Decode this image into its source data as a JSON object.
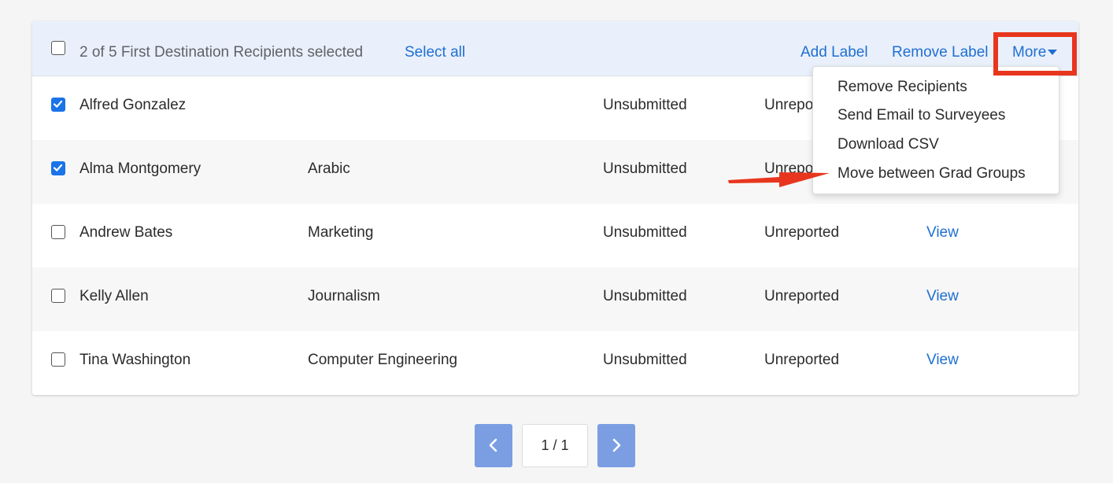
{
  "toolbar": {
    "selection_text": "2 of 5 First Destination Recipients selected",
    "select_all": "Select all",
    "add_label": "Add Label",
    "remove_label": "Remove Label",
    "more": "More"
  },
  "rows": [
    {
      "name": "Alfred Gonzalez",
      "program": "",
      "status": "Unsubmitted",
      "report": "Unrepo",
      "action": "",
      "checked": true
    },
    {
      "name": "Alma Montgomery",
      "program": "Arabic",
      "status": "Unsubmitted",
      "report": "Unrepo",
      "action": "",
      "checked": true
    },
    {
      "name": "Andrew Bates",
      "program": "Marketing",
      "status": "Unsubmitted",
      "report": "Unreported",
      "action": "View",
      "checked": false
    },
    {
      "name": "Kelly Allen",
      "program": "Journalism",
      "status": "Unsubmitted",
      "report": "Unreported",
      "action": "View",
      "checked": false
    },
    {
      "name": "Tina Washington",
      "program": "Computer Engineering",
      "status": "Unsubmitted",
      "report": "Unreported",
      "action": "View",
      "checked": false
    }
  ],
  "dropdown": {
    "items": [
      "Remove Recipients",
      "Send Email to Surveyees",
      "Download CSV",
      "Move between Grad Groups"
    ]
  },
  "pagination": {
    "page": "1 / 1"
  },
  "colors": {
    "accent": "#1f6fd1",
    "checkbox": "#1a73e8",
    "annotation": "#e8361e",
    "pager_button": "#7b9ee3"
  }
}
